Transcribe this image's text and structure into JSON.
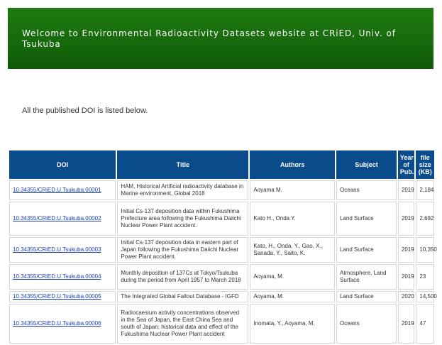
{
  "header": {
    "title": "Welcome to Environmental Radioactivity Datasets website at CRiED, Univ. of Tsukuba"
  },
  "intro": "All the published DOI is listed below.",
  "table": {
    "columns": [
      "DOI",
      "Title",
      "Authors",
      "Subject",
      "Year of Pub.",
      "file size (KB)"
    ],
    "rows": [
      {
        "doi": "10.34355/CRiED.U.Tsukuba.00001",
        "title": "HAM, Historical Artificial radioactivity database in Marine environment, Global 2018",
        "authors": "Aoyama M.",
        "subject": "Oceans",
        "year": "2019",
        "size": "2,184"
      },
      {
        "doi": "10.34355/CRiED.U.Tsukuba.00002",
        "title": "Initial Cs-137 deposition data within Fukushima Prefecture area following the Fukushima Daiichi Nuclear Power Plant accident.",
        "authors": "Kato H., Onda Y.",
        "subject": "Land Surface",
        "year": "2019",
        "size": "2,692"
      },
      {
        "doi": "10.34355/CRiED.U.Tsukuba.00003",
        "title": "Initial Cs-137 deposition data in eastern part of Japan following the Fukushima Daiichi Nuclear Power Plant accident.",
        "authors": "Kato, H., Onda, Y., Gao, X., Sanada, Y., Saito, K.",
        "subject": "Land Surface",
        "year": "2019",
        "size": "10,350"
      },
      {
        "doi": "10.34355/CRiED.U.Tsukuba.00004",
        "title": "Monthly deposition of 137Cs at Tokyo/Tsukuba during the period from April 1957 to March 2018",
        "authors": "Aoyama, M.",
        "subject": "Atmosphere, Land Surface",
        "year": "2019",
        "size": "23"
      },
      {
        "doi": "10.34355/CRiED.U.Tsukuba.00005",
        "title": "The Integrated Global Fallout Database - IGFD",
        "authors": "Aoyama, M.",
        "subject": "Land Surface",
        "year": "2020",
        "size": "14,500"
      },
      {
        "doi": "10.34355/CRiED.U.Tsukuba.00006",
        "title": "Radiocaesium activity concentrations observed in the Sea of Japan, the East China Sea and south of Japan: historical data and effect of the Fukushima Nuclear Power Plant accident",
        "authors": "Inomata, Y., Aoyama, M.",
        "subject": "Oceans",
        "year": "2019",
        "size": "47"
      }
    ]
  }
}
